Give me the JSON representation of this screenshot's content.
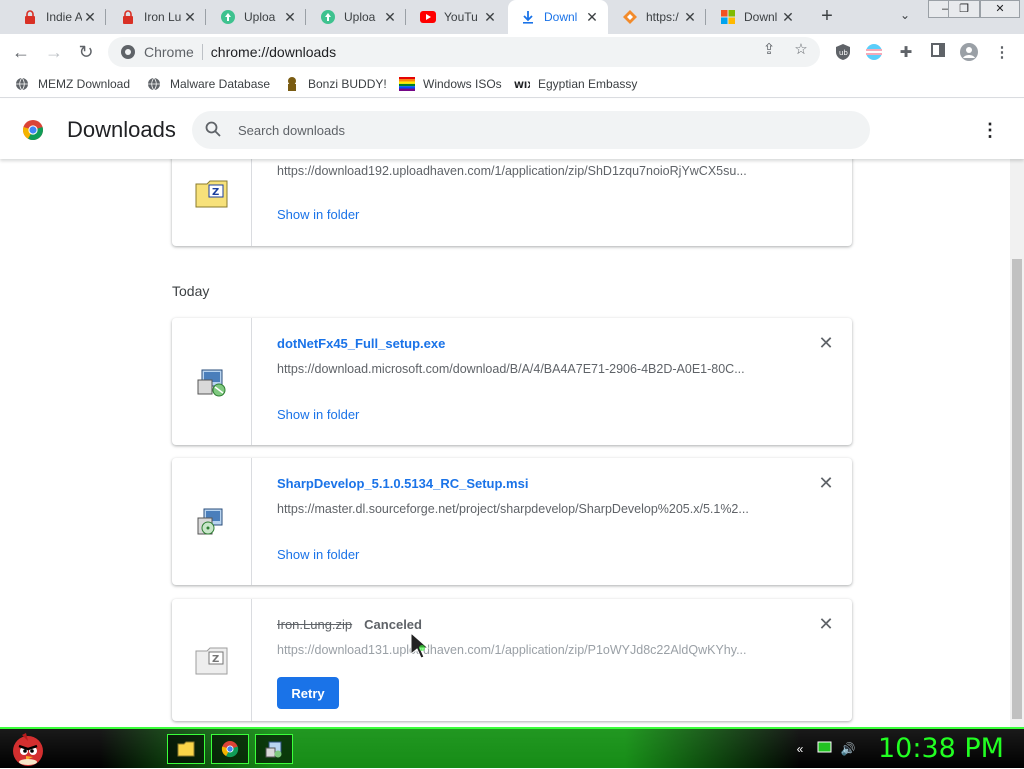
{
  "tabs": [
    {
      "title": "Indie A",
      "icon": "lock-red-icon"
    },
    {
      "title": "Iron Lu",
      "icon": "lock-red-icon"
    },
    {
      "title": "Uploa",
      "icon": "upload-haven-icon"
    },
    {
      "title": "Uploa",
      "icon": "upload-haven-icon"
    },
    {
      "title": "YouTu",
      "icon": "youtube-icon"
    },
    {
      "title": "Downl",
      "icon": "download-icon"
    },
    {
      "title": "https:/",
      "icon": "diamond-icon"
    },
    {
      "title": "Downl",
      "icon": "microsoft-icon"
    }
  ],
  "window_controls": {
    "minimize": "–",
    "restore": "❐",
    "close": "✕"
  },
  "omnibox": {
    "site_label": "Chrome",
    "url": "chrome://downloads"
  },
  "bookmarks": [
    {
      "label": "MEMZ Download",
      "icon": "globe-icon"
    },
    {
      "label": "Malware Database",
      "icon": "globe-icon"
    },
    {
      "label": "Bonzi BUDDY!",
      "icon": "bonzi-icon"
    },
    {
      "label": "Windows ISOs",
      "icon": "rainbow-flag-icon"
    },
    {
      "label": "Egyptian Embassy",
      "icon": "wix-icon"
    }
  ],
  "page": {
    "title": "Downloads",
    "search_placeholder": "Search downloads"
  },
  "downloads_earlier": {
    "url": "https://download192.uploadhaven.com/1/application/zip/ShD1zqu7noioRjYwCX5su...",
    "show_in_folder": "Show in folder"
  },
  "today_label": "Today",
  "downloads_today": [
    {
      "name": "dotNetFx45_Full_setup.exe",
      "url": "https://download.microsoft.com/download/B/A/4/BA4A7E71-2906-4B2D-A0E1-80C...",
      "show_in_folder": "Show in folder"
    },
    {
      "name": "SharpDevelop_5.1.0.5134_RC_Setup.msi",
      "url": "https://master.dl.sourceforge.net/project/sharpdevelop/SharpDevelop%205.x/5.1%2...",
      "show_in_folder": "Show in folder"
    },
    {
      "name": "Iron.Lung.zip",
      "status": "Canceled",
      "url": "https://download131.uploadhaven.com/1/application/zip/P1oWYJd8c22AldQwKYhy...",
      "retry_label": "Retry"
    }
  ],
  "taskbar": {
    "clock": "10:38 PM"
  },
  "colors": {
    "accent": "#1a73e8",
    "taskbar_green": "#22ff22"
  }
}
